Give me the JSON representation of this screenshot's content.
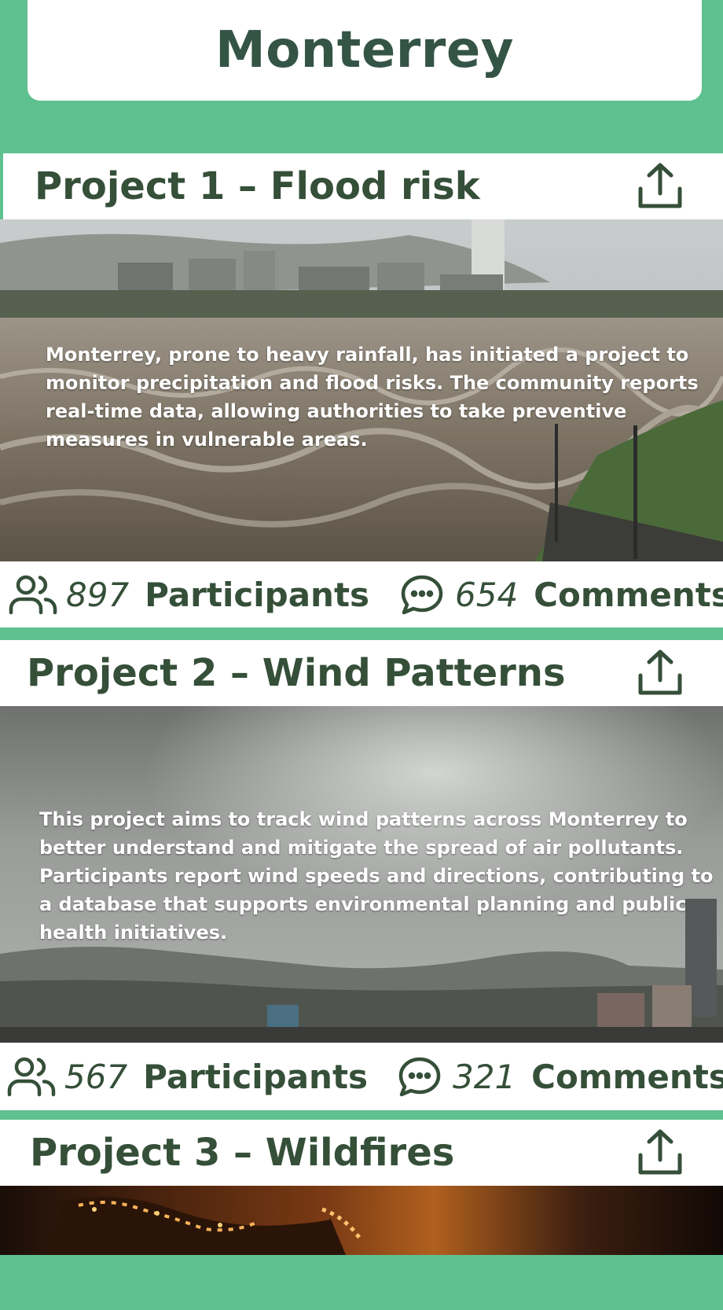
{
  "city": {
    "title": "Monterrey"
  },
  "projects": [
    {
      "title": "Project 1 – Flood risk",
      "description": "Monterrey, prone to heavy rainfall, has initiated a project to monitor precipitation and flood risks. The community reports real-time data, allowing authorities to take preventive measures in vulnerable areas.",
      "participants": "897",
      "participants_label": "Participants",
      "comments": "654",
      "comments_label": "Comments"
    },
    {
      "title": "Project 2 – Wind Patterns",
      "description": "This project aims to track wind patterns across Monterrey to better understand and mitigate the spread of air pollutants. Participants report wind speeds and directions, contributing to a database that supports environmental planning and public health initiatives.",
      "participants": "567",
      "participants_label": "Participants",
      "comments": "321",
      "comments_label": "Comments"
    },
    {
      "title": "Project 3 – Wildfires"
    }
  ],
  "icons": {
    "share": "share-icon",
    "participants": "users-icon",
    "comments": "comment-icon"
  },
  "colors": {
    "background": "#5fc090",
    "text_dark": "#354f38",
    "card": "#ffffff"
  }
}
